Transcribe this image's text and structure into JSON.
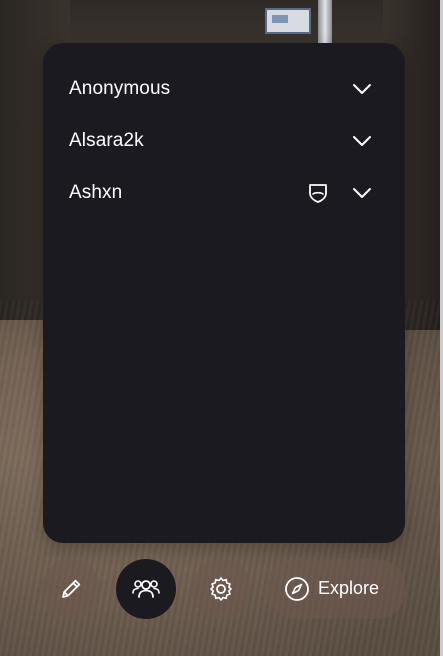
{
  "users": [
    {
      "name": "Anonymous",
      "has_shield": false
    },
    {
      "name": "Alsara2k",
      "has_shield": false
    },
    {
      "name": "Ashxn",
      "has_shield": true
    }
  ],
  "toolbar": {
    "edit_icon": "pencil-icon",
    "people_icon": "people-icon",
    "settings_icon": "gear-icon",
    "explore_icon": "compass-icon",
    "explore_label": "Explore",
    "active": "people"
  },
  "colors": {
    "panel_bg": "#1b1a21",
    "text": "#ffffff",
    "button_bg": "rgba(110, 88, 78, 0.55)"
  }
}
